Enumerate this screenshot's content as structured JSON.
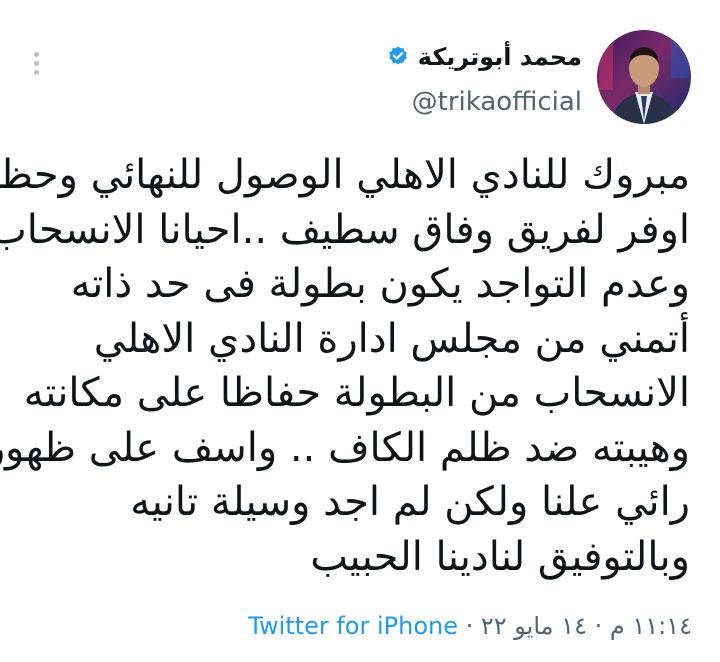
{
  "author": {
    "display_name": "محمد أبوتريكة",
    "handle": "@trikaofficial",
    "verified_icon": "verified-badge-icon",
    "accent_color": "#1d9bf0"
  },
  "tweet": {
    "lines": [
      "مبروك للنادي الاهلي الوصول للنهائي وحظ",
      "اوفر لفريق وفاق سطيف ..احيانا الانسحاب",
      "وعدم التواجد يكون بطولة فى حد ذاته",
      "أتمني من مجلس ادارة النادي الاهلي",
      "الانسحاب من البطولة حفاظا على مكانته",
      "وهيبته ضد ظلم الكاف .. واسف على ظهور",
      "رائي علنا ولكن لم اجد وسيلة تانيه",
      "وبالتوفيق لنادينا الحبيب"
    ]
  },
  "meta": {
    "time": "١١:١٤ م",
    "separator": " · ",
    "date": "١٤ مايو ٢٢",
    "source": "Twitter for iPhone"
  },
  "menu": {
    "icon": "more-options-icon"
  }
}
